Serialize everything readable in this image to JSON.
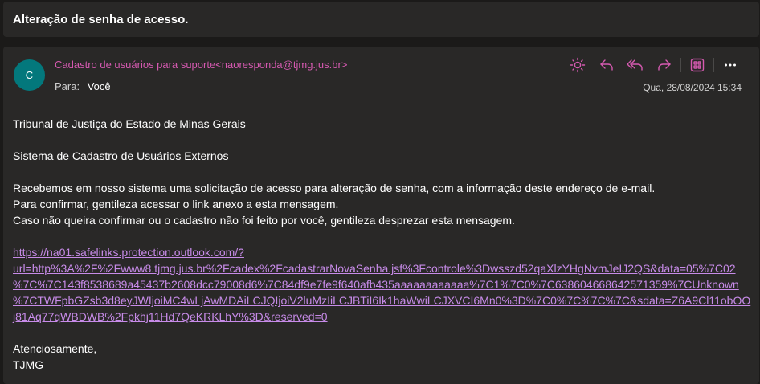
{
  "subject": "Alteração de senha de acesso.",
  "message": {
    "avatar_initial": "C",
    "sender": "Cadastro de usuários para suporte<naoresponda@tjmg.jus.br>",
    "to_label": "Para:",
    "to_name": "Você",
    "date": "Qua, 28/08/2024 15:34",
    "actions": [
      "sun-icon",
      "reply-icon",
      "reply-all-icon",
      "forward-icon",
      "apps-icon",
      "more-icon"
    ]
  },
  "body": {
    "line1": "Tribunal de Justiça do Estado de Minas Gerais",
    "line2": "Sistema de Cadastro de Usuários Externos",
    "para1": "Recebemos em nosso sistema uma solicitação de acesso para alteração de senha, com a informação deste endereço de e-mail.",
    "para2": "Para confirmar, gentileza acessar o link anexo a esta mensagem.",
    "para3": "Caso não queira confirmar ou o cadastro não foi feito por você, gentileza desprezar esta mensagem.",
    "link_lines": [
      "https://na01.safelinks.protection.outlook.com/?",
      "url=http%3A%2F%2Fwww8.tjmg.jus.br%2Fcadex%2FcadastrarNovaSenha.jsf%3Fcontrole%3Dwsszd52qaXlzYHgNvmJeIJ2QS&data=05%7C02",
      "%7C%7C143f8538689a45437b2608dcc79008d6%7C84df9e7fe9f640afb435aaaaaaaaaaaa%7C1%7C0%7C638604668642571359%7CUnknown",
      "%7CTWFpbGZsb3d8eyJWIjoiMC4wLjAwMDAiLCJQIjoiV2luMzIiLCJBTiI6Ik1haWwiLCJXVCI6Mn0%3D%7C0%7C%7C%7C&sdata=Z6A9Cl11obOO",
      "j81Aq77qWBDWB%2Fpkhj11Hd7QeKRKLhY%3D&reserved=0"
    ],
    "closing": "Atenciosamente,",
    "signature": "TJMG"
  },
  "colors": {
    "sender": "#d65ab1",
    "link": "#c78be8",
    "avatar": "#03787c",
    "icon_accent": "#d65ab1"
  }
}
